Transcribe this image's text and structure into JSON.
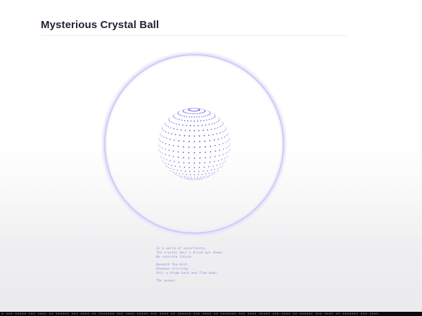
{
  "page": {
    "title": "Mysterious Crystal Ball"
  },
  "crystal_ball": {
    "ring_color": "#c9c8f3",
    "dot_color": "#3d3bd6"
  },
  "prophecy": {
    "stanzas": [
      [
        "In a world of uncertainty,",
        "The crystal ball's blind eye shows",
        "No concrete future."
      ],
      [
        "Beneath the mist,",
        "Shadows stirring: ...",
        "Stir a dream back and flow down."
      ],
      [
        "The answer"
      ]
    ]
  },
  "status_strip": {
    "text": "▪ ▪▪▪ ▪▪▪▪▪ ▪▪▪ ▪▪▪▪ ▪▪ ▪▪▪▪▪▪ ▪▪▪ ▪▪▪▪ ▪▪ ▪▪▪▪▪▪▪ ▪▪▪ ▪▪▪▪ ▪▪▪▪▪ ▪▪▪ ▪▪▪▪ ▪▪ ▪▪▪▪▪▪ ▪▪▪ ▪▪▪▪ ▪▪ ▪▪▪▪▪▪▪ ▪▪▪ ▪▪▪▪ ▪▪▪▪▪ ▪▪▪ ▪▪▪▪ ▪▪ ▪▪▪▪▪▪ ▪▪▪ ▪▪▪▪ ▪▪ ▪▪▪▪▪▪▪ ▪▪▪ ▪▪▪▪"
  }
}
